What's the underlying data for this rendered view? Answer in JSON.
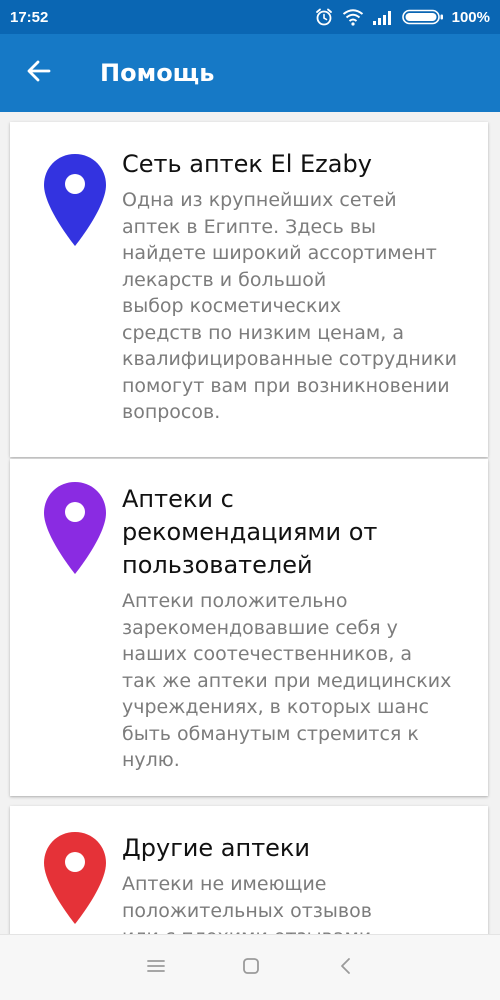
{
  "status_bar": {
    "time": "17:52",
    "battery": "100%",
    "icons": [
      "alarm-icon",
      "wifi-icon",
      "signal-icon",
      "battery-icon"
    ]
  },
  "app_bar": {
    "title": "Помощь",
    "back_icon": "arrow-back-icon"
  },
  "cards": [
    {
      "title": "Сеть аптек El Ezaby",
      "description": "Одна из крупнейших сетей\nаптек в Египте. Здесь вы\nнайдете широкий ассортимент\nлекарств и большой\nвыбор косметических\nсредств по низким ценам, а\nквалифицированные сотрудники\nпомогут вам при возникновении\nвопросов.",
      "pin_color": "#3333e0",
      "icon": "location-pin-icon"
    },
    {
      "title": "Аптеки с\nрекомендациями от\nпользователей",
      "description": "Аптеки положительно\nзарекомендовавшие себя у\nнаших соотечественников, а\nтак же аптеки при медицинских\nучреждениях, в которых шанс\nбыть обманутым стремится к\nнулю.",
      "pin_color": "#8a2be2",
      "icon": "location-pin-icon"
    },
    {
      "title": "Другие аптеки",
      "description": "Аптеки не имеющие\nположительных отзывов\nили с плохими отзывами",
      "pin_color": "#e53238",
      "icon": "location-pin-icon"
    }
  ],
  "nav_bar": {
    "icons": [
      "menu-icon",
      "home-square-icon",
      "back-chevron-icon"
    ]
  },
  "colors": {
    "status_bar": "#0a66b3",
    "app_bar": "#1679c6",
    "background": "#f2f2f2"
  }
}
